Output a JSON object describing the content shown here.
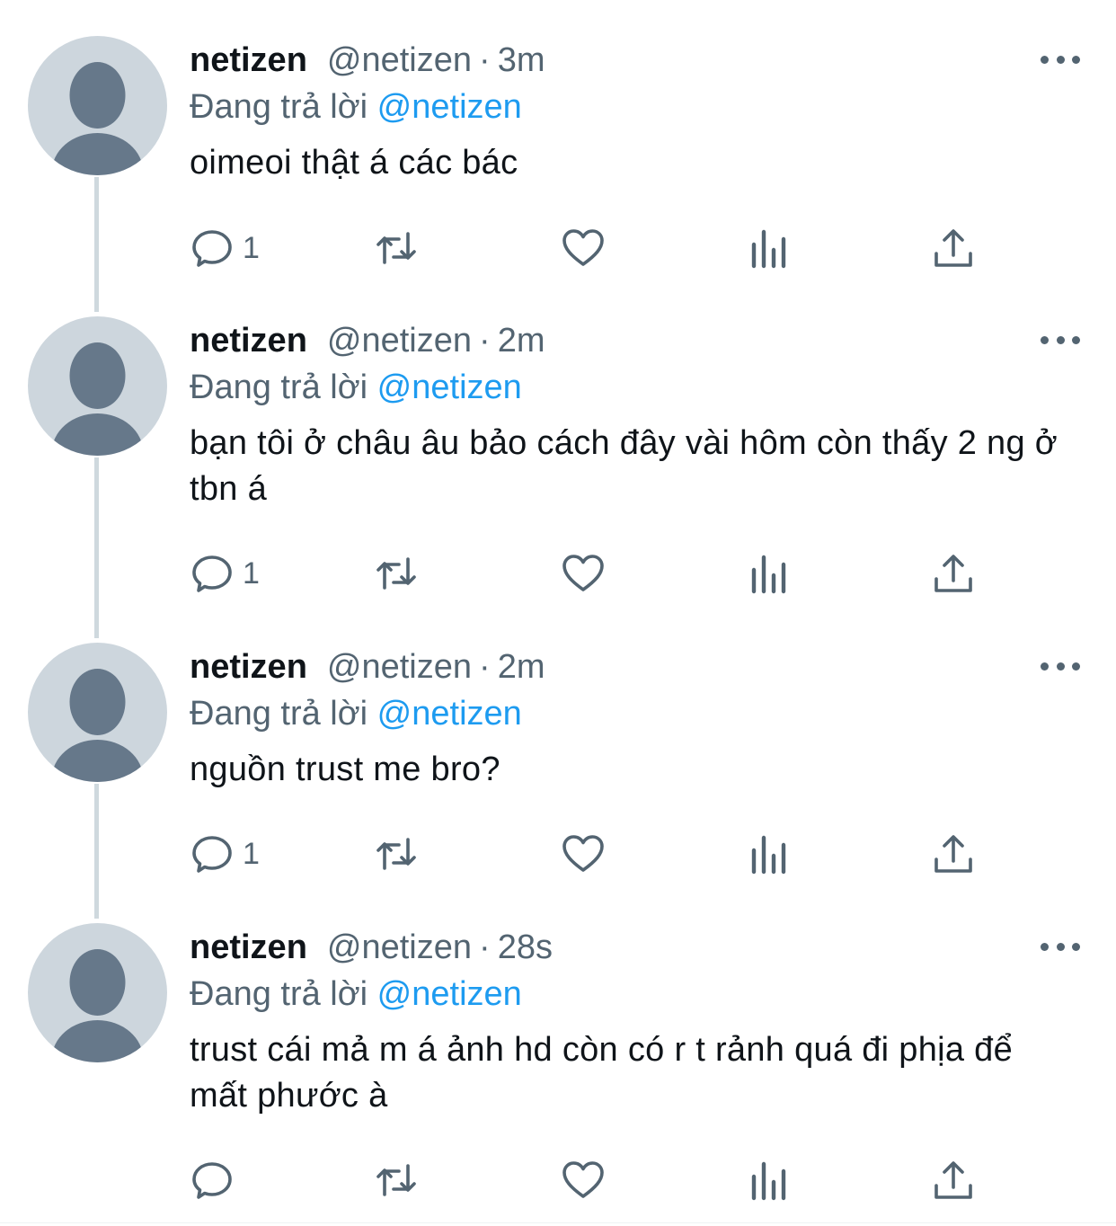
{
  "colors": {
    "text": "#0f1419",
    "secondary": "#536471",
    "accent": "#1d9bf0",
    "avatar_bg": "#cdd6dd",
    "thread_line": "#cfd9de"
  },
  "tweets": [
    {
      "name": "netizen",
      "handle": "@netizen",
      "separator": "·",
      "time": "3m",
      "replying_label": "Đang trả lời",
      "replying_to": "@netizen",
      "text": "oimeoi thật á các bác",
      "reply_count": "1",
      "icons": [
        "reply-icon",
        "retweet-icon",
        "like-icon",
        "views-icon",
        "share-icon",
        "more-icon"
      ]
    },
    {
      "name": "netizen",
      "handle": "@netizen",
      "separator": "·",
      "time": "2m",
      "replying_label": "Đang trả lời",
      "replying_to": "@netizen",
      "text": "bạn tôi ở châu âu bảo cách đây vài hôm còn thấy 2 ng ở tbn á",
      "reply_count": "1",
      "icons": [
        "reply-icon",
        "retweet-icon",
        "like-icon",
        "views-icon",
        "share-icon",
        "more-icon"
      ]
    },
    {
      "name": "netizen",
      "handle": "@netizen",
      "separator": "·",
      "time": "2m",
      "replying_label": "Đang trả lời",
      "replying_to": "@netizen",
      "text": "nguồn trust me bro?",
      "reply_count": "1",
      "icons": [
        "reply-icon",
        "retweet-icon",
        "like-icon",
        "views-icon",
        "share-icon",
        "more-icon"
      ]
    },
    {
      "name": "netizen",
      "handle": "@netizen",
      "separator": "·",
      "time": "28s",
      "replying_label": "Đang trả lời",
      "replying_to": "@netizen",
      "text": "trust cái mả m á ảnh hd còn có r t rảnh quá đi phịa để mất phước à",
      "reply_count": "",
      "icons": [
        "reply-icon",
        "retweet-icon",
        "like-icon",
        "views-icon",
        "share-icon",
        "more-icon"
      ]
    }
  ]
}
